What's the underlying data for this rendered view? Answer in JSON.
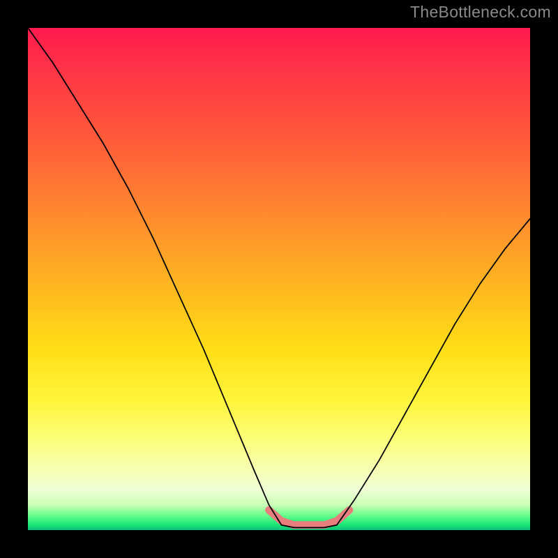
{
  "attribution": "TheBottleneck.com",
  "chart_data": {
    "type": "line",
    "title": "",
    "xlabel": "",
    "ylabel": "",
    "xlim": [
      0,
      1
    ],
    "ylim": [
      0,
      100
    ],
    "series": [
      {
        "name": "left-curve",
        "x": [
          0.0,
          0.05,
          0.1,
          0.15,
          0.2,
          0.25,
          0.3,
          0.35,
          0.4,
          0.45,
          0.48,
          0.505
        ],
        "values": [
          100,
          93,
          85,
          77,
          68,
          58,
          47,
          36,
          24,
          12,
          5,
          1
        ]
      },
      {
        "name": "valley-floor",
        "x": [
          0.505,
          0.53,
          0.56,
          0.59,
          0.615
        ],
        "values": [
          1,
          0.5,
          0.5,
          0.5,
          1
        ]
      },
      {
        "name": "right-curve",
        "x": [
          0.615,
          0.65,
          0.7,
          0.75,
          0.8,
          0.85,
          0.9,
          0.95,
          1.0
        ],
        "values": [
          1,
          6,
          14,
          23,
          32,
          41,
          49,
          56,
          62
        ]
      },
      {
        "name": "pink-highlight",
        "x": [
          0.48,
          0.505,
          0.53,
          0.56,
          0.59,
          0.615,
          0.64
        ],
        "values": [
          4,
          1.8,
          1,
          1,
          1,
          1.8,
          4
        ]
      }
    ],
    "colors": {
      "curve": "#000000",
      "highlight": "#e77d7d",
      "gradient_top": "#ff1a4d",
      "gradient_bottom": "#0fbf7a"
    }
  }
}
